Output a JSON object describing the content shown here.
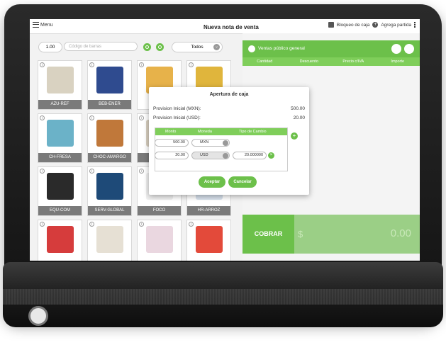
{
  "topbar": {
    "menu_label": "Menu",
    "title": "Nueva nota de venta",
    "lock_label": "Bloqueo de caja",
    "add_label": "Agrega partida"
  },
  "toolbar": {
    "quantity": "1.00",
    "barcode_placeholder": "Código de barras",
    "filter_value": "Todos"
  },
  "products": [
    {
      "label": "AZU-REF",
      "color": "#d9d2c1"
    },
    {
      "label": "BEB-ENER",
      "color": "#2f4b8f"
    },
    {
      "label": "",
      "color": "#e7b24a"
    },
    {
      "label": "",
      "color": "#e0b53c"
    },
    {
      "label": "CH-FRESA",
      "color": "#6bb2c8"
    },
    {
      "label": "CHOC-AMARGO",
      "color": "#c0783a"
    },
    {
      "label": "C",
      "color": "#d8cfc0"
    },
    {
      "label": "",
      "color": "#f0f0f0"
    },
    {
      "label": "EQU-COM",
      "color": "#2a2a2a"
    },
    {
      "label": "SERV-GLOBAL",
      "color": "#1e4a78"
    },
    {
      "label": "FOCO",
      "color": "#f0f0f0"
    },
    {
      "label": "HR-ARROZ",
      "color": "#d7e1ec"
    },
    {
      "label": "",
      "color": "#d63c3c"
    },
    {
      "label": "",
      "color": "#e6e0d4"
    },
    {
      "label": "",
      "color": "#ead7e0"
    },
    {
      "label": "",
      "color": "#e34a3a"
    }
  ],
  "client": {
    "name": "Ventas público general"
  },
  "sale_table": {
    "columns": [
      "Cantidad",
      "Descuento",
      "Precio c/IVA",
      "Importe"
    ]
  },
  "checkout": {
    "label": "COBRAR",
    "currency": "$",
    "total": "0.00"
  },
  "modal": {
    "title": "Apertura de caja",
    "provision_mxn_label": "Provision Inicial (MXN):",
    "provision_mxn_value": "500.00",
    "provision_usd_label": "Provision Inicial (USD):",
    "provision_usd_value": "20.00",
    "table_headers": [
      "Monto",
      "Moneda",
      "Tipo de Cambio"
    ],
    "rows": [
      {
        "monto": "500.00",
        "moneda": "MXN",
        "tipo": ""
      },
      {
        "monto": "20.00",
        "moneda": "USD",
        "tipo": "20.000000"
      }
    ],
    "accept_label": "Aceptar",
    "cancel_label": "Cancelar"
  },
  "colors": {
    "accent": "#6cc04a",
    "header_green": "#7fce5a",
    "label_grey": "#7a7a7a"
  }
}
